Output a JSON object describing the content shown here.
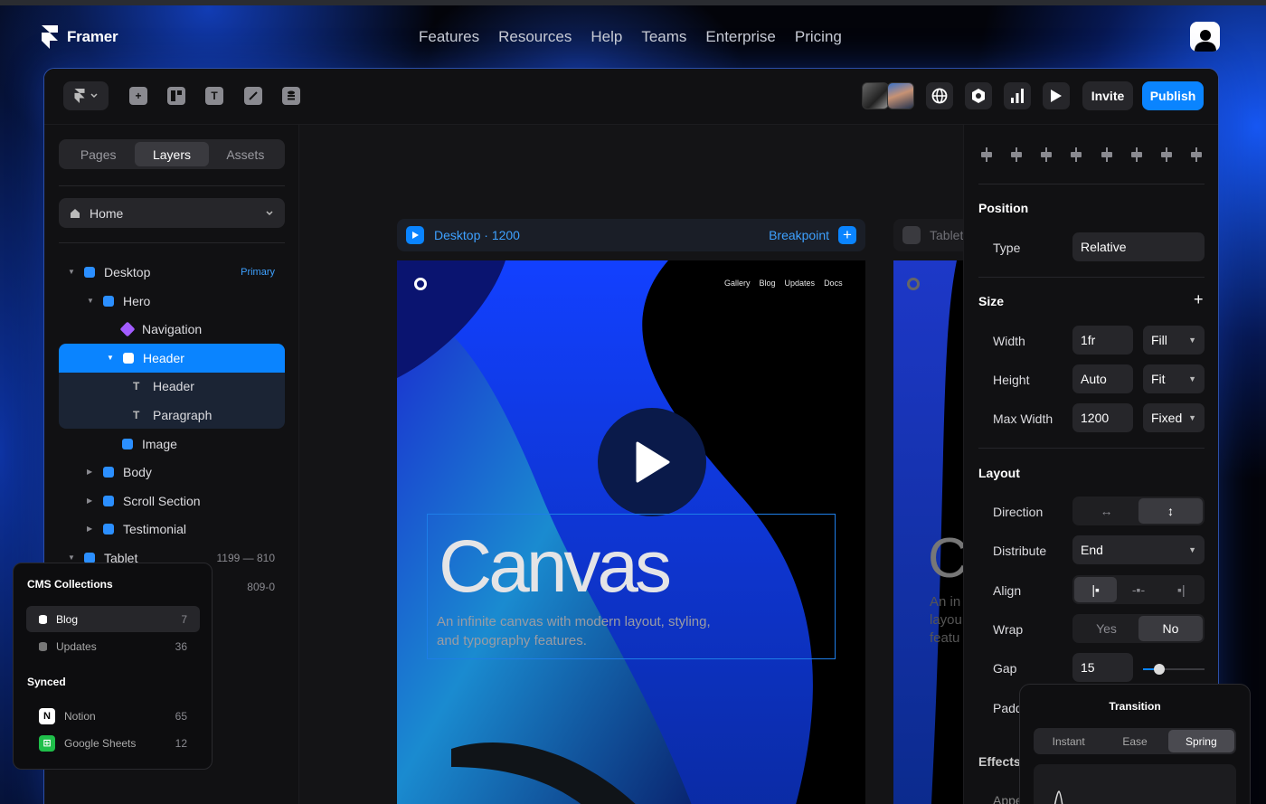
{
  "site": {
    "brand": "Framer",
    "nav": [
      "Features",
      "Resources",
      "Help",
      "Teams",
      "Enterprise",
      "Pricing"
    ]
  },
  "toolbar": {
    "invite_label": "Invite",
    "publish_label": "Publish",
    "accent": "#0a84ff"
  },
  "left_panel": {
    "tabs": [
      "Pages",
      "Layers",
      "Assets"
    ],
    "active_tab": "Layers",
    "page_select": "Home",
    "layers": [
      {
        "label": "Desktop",
        "badge": "Primary"
      },
      {
        "label": "Hero"
      },
      {
        "label": "Navigation"
      },
      {
        "label": "Header"
      },
      {
        "label": "Header"
      },
      {
        "label": "Paragraph"
      },
      {
        "label": "Image"
      },
      {
        "label": "Body"
      },
      {
        "label": "Scroll Section"
      },
      {
        "label": "Testimonial"
      },
      {
        "label": "Tablet",
        "range": "1199 — 810"
      },
      {
        "range": "809-0"
      }
    ]
  },
  "cms": {
    "title": "CMS Collections",
    "collections": [
      {
        "name": "Blog",
        "count": "7"
      },
      {
        "name": "Updates",
        "count": "36"
      }
    ],
    "synced_title": "Synced",
    "synced": [
      {
        "name": "Notion",
        "count": "65"
      },
      {
        "name": "Google Sheets",
        "count": "12"
      }
    ]
  },
  "canvas": {
    "desktop_frame": {
      "name": "Desktop",
      "width": "1200",
      "breakpoint_label": "Breakpoint"
    },
    "tablet_frame": {
      "name": "Tablet"
    },
    "site_nav": [
      "Gallery",
      "Blog",
      "Updates",
      "Docs"
    ],
    "headline": "Canvas",
    "subline": "An infinite canvas with modern layout, styling, and typography features.",
    "tablet_headline": "C",
    "tablet_subline": "An in\nlayou\nfeatu"
  },
  "right_panel": {
    "position": {
      "title": "Position",
      "type_label": "Type",
      "type_value": "Relative"
    },
    "size": {
      "title": "Size",
      "width_label": "Width",
      "width_value": "1fr",
      "width_mode": "Fill",
      "height_label": "Height",
      "height_value": "Auto",
      "height_mode": "Fit",
      "max_label": "Max Width",
      "max_value": "1200",
      "max_mode": "Fixed"
    },
    "layout": {
      "title": "Layout",
      "direction_label": "Direction",
      "distribute_label": "Distribute",
      "distribute_value": "End",
      "align_label": "Align",
      "wrap_label": "Wrap",
      "wrap_yes": "Yes",
      "wrap_no": "No",
      "gap_label": "Gap",
      "gap_value": "15",
      "padding_label": "Padd"
    },
    "effects_title": "Effects",
    "appear_label": "Appe"
  },
  "transition": {
    "title": "Transition",
    "options": [
      "Instant",
      "Ease",
      "Spring"
    ],
    "selected": "Spring"
  }
}
